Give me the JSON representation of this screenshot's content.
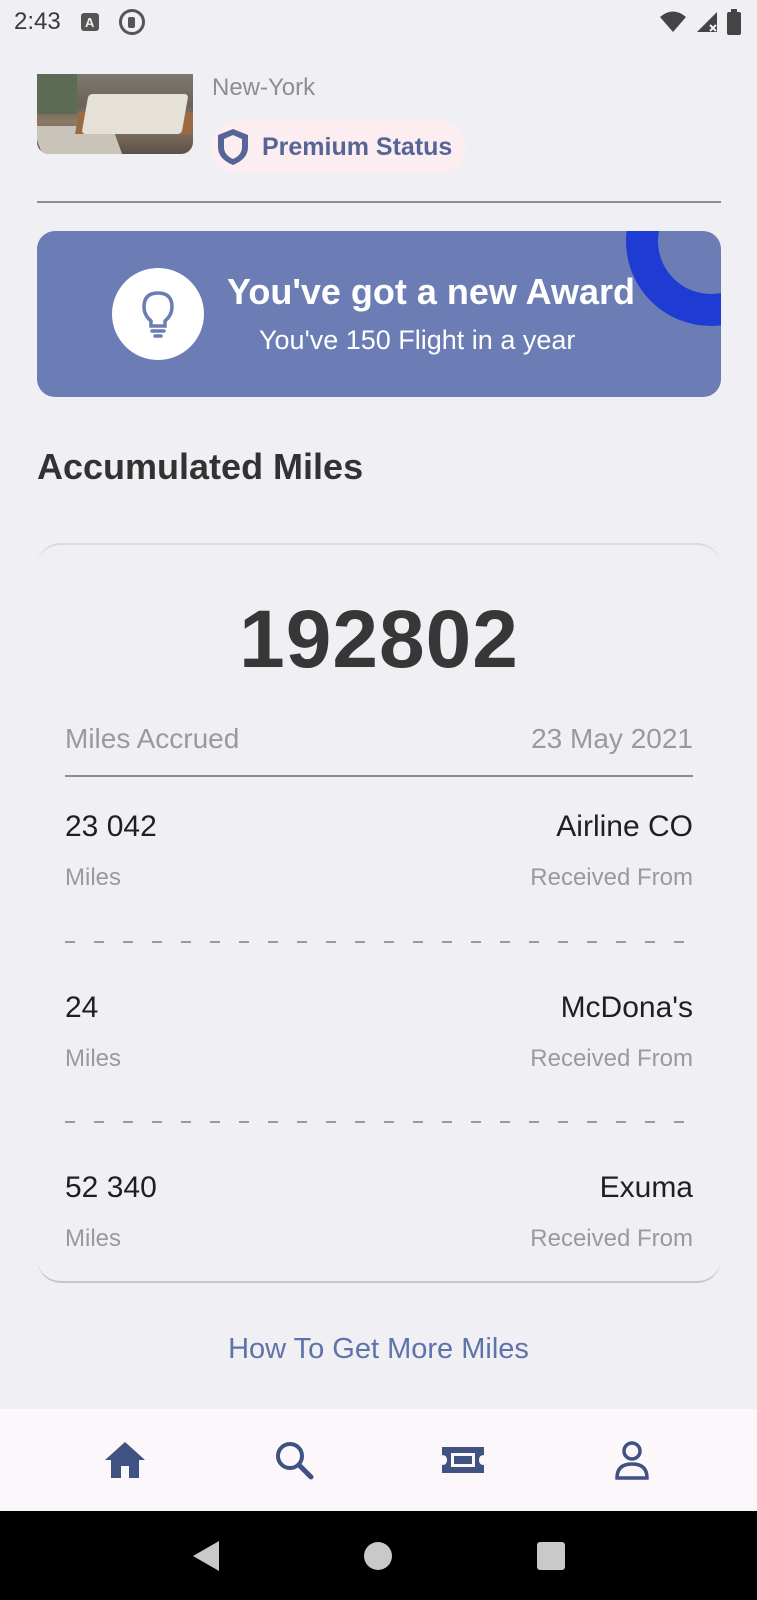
{
  "status_bar": {
    "time": "2:43",
    "icons": [
      "a-notification-icon",
      "p-notification-icon",
      "wifi-icon",
      "signal-icon",
      "battery-icon"
    ]
  },
  "profile": {
    "city": "New-York",
    "status_label": "Premium Status"
  },
  "award": {
    "title": "You've got a new Award",
    "subtitle": "You've 150 Flight in a year",
    "icon": "lightbulb-icon"
  },
  "miles": {
    "section_title": "Accumulated Miles",
    "total": "192802",
    "accrued_label": "Miles Accrued",
    "accrued_date": "23 May 2021",
    "entries": [
      {
        "value": "23 042",
        "unit": "Miles",
        "source": "Airline CO",
        "caption": "Received From"
      },
      {
        "value": "24",
        "unit": "Miles",
        "source": "McDona's",
        "caption": "Received From"
      },
      {
        "value": "52 340",
        "unit": "Miles",
        "source": "Exuma",
        "caption": "Received From"
      }
    ]
  },
  "more_link": "How To Get More Miles",
  "bottom_nav": {
    "items": [
      "home-icon",
      "search-icon",
      "ticket-icon",
      "profile-icon"
    ]
  },
  "colors": {
    "accent": "#6b7db4",
    "ring": "#1e3bd4",
    "link": "#5f73aa",
    "premium_text": "#566497"
  }
}
